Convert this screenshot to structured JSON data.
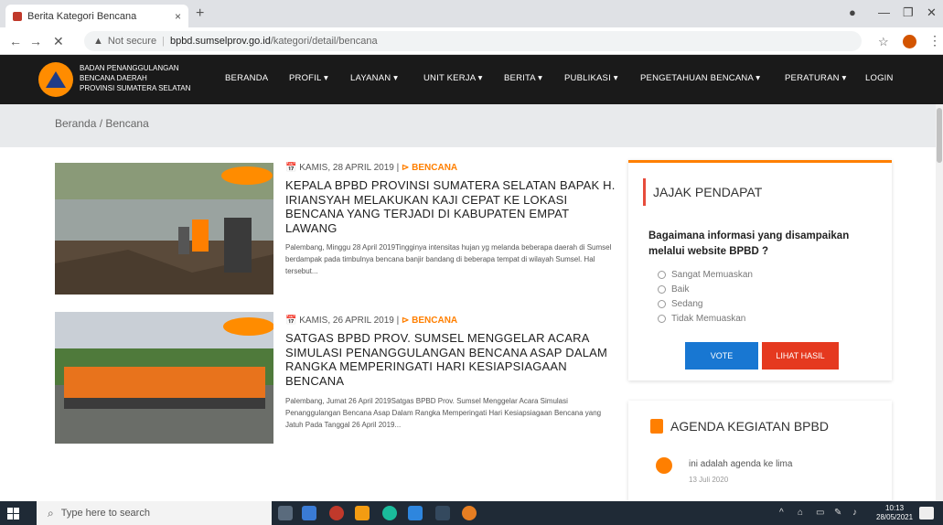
{
  "browser": {
    "tab_title": "Berita Kategori Bencana",
    "tab_close": "×",
    "new_tab": "+",
    "url_warning": "Not secure",
    "url_host": "bpbd.sumselprov.go.id",
    "url_path": "/kategori/detail/bencana"
  },
  "site": {
    "org_line1": "BADAN PENANGGULANGAN",
    "org_line2": "BENCANA DAERAH",
    "org_line3": "PROVINSI SUMATERA SELATAN",
    "menu": [
      {
        "label": "BERANDA"
      },
      {
        "label": "PROFIL ▾"
      },
      {
        "label": "LAYANAN ▾"
      },
      {
        "label": "UNIT KERJA ▾"
      },
      {
        "label": "BERITA ▾"
      },
      {
        "label": "PUBLIKASI ▾"
      },
      {
        "label": "PENGETAHUAN BENCANA ▾"
      },
      {
        "label": "PERATURAN ▾"
      },
      {
        "label": "LOGIN"
      }
    ]
  },
  "breadcrumb": "Beranda / Bencana",
  "articles": [
    {
      "date": "KAMIS, 28 APRIL 2019 |",
      "category": "BENCANA",
      "title": "KEPALA BPBD PROVINSI SUMATERA SELATAN BAPAK H. IRIANSYAH MELAKUKAN KAJI CEPAT KE LOKASI BENCANA YANG TERJADI DI KABUPATEN EMPAT LAWANG",
      "excerpt": "Palembang, Minggu 28 April 2019Tingginya intensitas hujan yg melanda beberapa daerah di Sumsel berdampak pada timbulnya bencana banjir bandang di beberapa tempat di wilayah Sumsel. Hal tersebut..."
    },
    {
      "date": "KAMIS, 26 APRIL 2019 |",
      "category": "BENCANA",
      "title": "SATGAS BPBD PROV. SUMSEL MENGGELAR ACARA SIMULASI PENANGGULANGAN BENCANA ASAP DALAM RANGKA MEMPERINGATI HARI KESIAPSIAGAAN BENCANA",
      "excerpt": "Palembang, Jumat 26 April 2019Satgas BPBD Prov. Sumsel Menggelar Acara Simulasi Penanggulangan Bencana Asap Dalam Rangka Memperingati Hari Kesiapsiagaan Bencana yang Jatuh Pada Tanggal 26 April 2019..."
    }
  ],
  "poll": {
    "heading": "JAJAK PENDAPAT",
    "question": "Bagaimana informasi yang disampaikan melalui website BPBD ?",
    "options": [
      "Sangat Memuaskan",
      "Baik",
      "Sedang",
      "Tidak Memuaskan"
    ],
    "vote_label": "VOTE",
    "result_label": "LIHAT HASIL"
  },
  "agenda": {
    "heading": "AGENDA KEGIATAN BPBD",
    "item_text": "ini adalah agenda ke lima",
    "item_date": "13 Juli 2020"
  },
  "taskbar": {
    "search_placeholder": "Type here to search",
    "time": "10:13",
    "date": "28/05/2021"
  },
  "colors": {
    "accent": "#ff7f00",
    "nav_bg": "#1a1a1a",
    "vote_button": "#1877d2",
    "result_button": "#e5391f"
  }
}
